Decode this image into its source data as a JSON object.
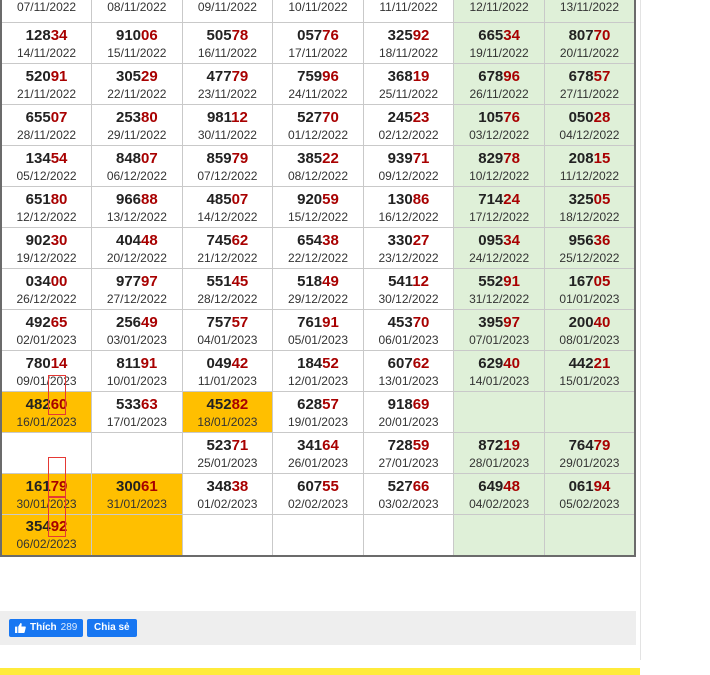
{
  "rows": [
    [
      {
        "num": "",
        "hl": "",
        "date": "07/11/2022",
        "bg": "white"
      },
      {
        "num": "",
        "hl": "",
        "date": "08/11/2022",
        "bg": "white"
      },
      {
        "num": "",
        "hl": "",
        "date": "09/11/2022",
        "bg": "white"
      },
      {
        "num": "",
        "hl": "",
        "date": "10/11/2022",
        "bg": "white"
      },
      {
        "num": "",
        "hl": "",
        "date": "11/11/2022",
        "bg": "white"
      },
      {
        "num": "",
        "hl": "",
        "date": "12/11/2022",
        "bg": "green"
      },
      {
        "num": "",
        "hl": "",
        "date": "13/11/2022",
        "bg": "green"
      }
    ],
    [
      {
        "num": "128",
        "hl": "34",
        "date": "14/11/2022",
        "bg": "white"
      },
      {
        "num": "910",
        "hl": "06",
        "date": "15/11/2022",
        "bg": "white"
      },
      {
        "num": "505",
        "hl": "78",
        "date": "16/11/2022",
        "bg": "white"
      },
      {
        "num": "057",
        "hl": "76",
        "date": "17/11/2022",
        "bg": "white"
      },
      {
        "num": "325",
        "hl": "92",
        "date": "18/11/2022",
        "bg": "white"
      },
      {
        "num": "665",
        "hl": "34",
        "date": "19/11/2022",
        "bg": "green"
      },
      {
        "num": "807",
        "hl": "70",
        "date": "20/11/2022",
        "bg": "green"
      }
    ],
    [
      {
        "num": "520",
        "hl": "91",
        "date": "21/11/2022",
        "bg": "white"
      },
      {
        "num": "305",
        "hl": "29",
        "date": "22/11/2022",
        "bg": "white"
      },
      {
        "num": "477",
        "hl": "79",
        "date": "23/11/2022",
        "bg": "white"
      },
      {
        "num": "759",
        "hl": "96",
        "date": "24/11/2022",
        "bg": "white"
      },
      {
        "num": "368",
        "hl": "19",
        "date": "25/11/2022",
        "bg": "white"
      },
      {
        "num": "678",
        "hl": "96",
        "date": "26/11/2022",
        "bg": "green"
      },
      {
        "num": "678",
        "hl": "57",
        "date": "27/11/2022",
        "bg": "green"
      }
    ],
    [
      {
        "num": "655",
        "hl": "07",
        "date": "28/11/2022",
        "bg": "white"
      },
      {
        "num": "253",
        "hl": "80",
        "date": "29/11/2022",
        "bg": "white"
      },
      {
        "num": "981",
        "hl": "12",
        "date": "30/11/2022",
        "bg": "white"
      },
      {
        "num": "527",
        "hl": "70",
        "date": "01/12/2022",
        "bg": "white"
      },
      {
        "num": "245",
        "hl": "23",
        "date": "02/12/2022",
        "bg": "white"
      },
      {
        "num": "105",
        "hl": "76",
        "date": "03/12/2022",
        "bg": "green"
      },
      {
        "num": "050",
        "hl": "28",
        "date": "04/12/2022",
        "bg": "green"
      }
    ],
    [
      {
        "num": "134",
        "hl": "54",
        "date": "05/12/2022",
        "bg": "white"
      },
      {
        "num": "848",
        "hl": "07",
        "date": "06/12/2022",
        "bg": "white"
      },
      {
        "num": "859",
        "hl": "79",
        "date": "07/12/2022",
        "bg": "white"
      },
      {
        "num": "385",
        "hl": "22",
        "date": "08/12/2022",
        "bg": "white"
      },
      {
        "num": "939",
        "hl": "71",
        "date": "09/12/2022",
        "bg": "white"
      },
      {
        "num": "829",
        "hl": "78",
        "date": "10/12/2022",
        "bg": "green"
      },
      {
        "num": "208",
        "hl": "15",
        "date": "11/12/2022",
        "bg": "green"
      }
    ],
    [
      {
        "num": "651",
        "hl": "80",
        "date": "12/12/2022",
        "bg": "white"
      },
      {
        "num": "966",
        "hl": "88",
        "date": "13/12/2022",
        "bg": "white"
      },
      {
        "num": "485",
        "hl": "07",
        "date": "14/12/2022",
        "bg": "white"
      },
      {
        "num": "920",
        "hl": "59",
        "date": "15/12/2022",
        "bg": "white"
      },
      {
        "num": "130",
        "hl": "86",
        "date": "16/12/2022",
        "bg": "white"
      },
      {
        "num": "714",
        "hl": "24",
        "date": "17/12/2022",
        "bg": "green"
      },
      {
        "num": "325",
        "hl": "05",
        "date": "18/12/2022",
        "bg": "green"
      }
    ],
    [
      {
        "num": "902",
        "hl": "30",
        "date": "19/12/2022",
        "bg": "white"
      },
      {
        "num": "404",
        "hl": "48",
        "date": "20/12/2022",
        "bg": "white"
      },
      {
        "num": "745",
        "hl": "62",
        "date": "21/12/2022",
        "bg": "white"
      },
      {
        "num": "654",
        "hl": "38",
        "date": "22/12/2022",
        "bg": "white"
      },
      {
        "num": "330",
        "hl": "27",
        "date": "23/12/2022",
        "bg": "white"
      },
      {
        "num": "095",
        "hl": "34",
        "date": "24/12/2022",
        "bg": "green"
      },
      {
        "num": "956",
        "hl": "36",
        "date": "25/12/2022",
        "bg": "green"
      }
    ],
    [
      {
        "num": "034",
        "hl": "00",
        "date": "26/12/2022",
        "bg": "white"
      },
      {
        "num": "977",
        "hl": "97",
        "date": "27/12/2022",
        "bg": "white"
      },
      {
        "num": "551",
        "hl": "45",
        "date": "28/12/2022",
        "bg": "white"
      },
      {
        "num": "518",
        "hl": "49",
        "date": "29/12/2022",
        "bg": "white"
      },
      {
        "num": "541",
        "hl": "12",
        "date": "30/12/2022",
        "bg": "white"
      },
      {
        "num": "552",
        "hl": "91",
        "date": "31/12/2022",
        "bg": "green"
      },
      {
        "num": "167",
        "hl": "05",
        "date": "01/01/2023",
        "bg": "green"
      }
    ],
    [
      {
        "num": "492",
        "hl": "65",
        "date": "02/01/2023",
        "bg": "white"
      },
      {
        "num": "256",
        "hl": "49",
        "date": "03/01/2023",
        "bg": "white"
      },
      {
        "num": "757",
        "hl": "57",
        "date": "04/01/2023",
        "bg": "white"
      },
      {
        "num": "761",
        "hl": "91",
        "date": "05/01/2023",
        "bg": "white"
      },
      {
        "num": "453",
        "hl": "70",
        "date": "06/01/2023",
        "bg": "white"
      },
      {
        "num": "395",
        "hl": "97",
        "date": "07/01/2023",
        "bg": "green"
      },
      {
        "num": "200",
        "hl": "40",
        "date": "08/01/2023",
        "bg": "green"
      }
    ],
    [
      {
        "num": "780",
        "hl": "14",
        "date": "09/01/2023",
        "bg": "white"
      },
      {
        "num": "811",
        "hl": "91",
        "date": "10/01/2023",
        "bg": "white"
      },
      {
        "num": "049",
        "hl": "42",
        "date": "11/01/2023",
        "bg": "white"
      },
      {
        "num": "184",
        "hl": "52",
        "date": "12/01/2023",
        "bg": "white"
      },
      {
        "num": "607",
        "hl": "62",
        "date": "13/01/2023",
        "bg": "white"
      },
      {
        "num": "629",
        "hl": "40",
        "date": "14/01/2023",
        "bg": "green"
      },
      {
        "num": "442",
        "hl": "21",
        "date": "15/01/2023",
        "bg": "green"
      }
    ],
    [
      {
        "num": "482",
        "hl": "60",
        "date": "16/01/2023",
        "bg": "yellow",
        "boxed": true
      },
      {
        "num": "533",
        "hl": "63",
        "date": "17/01/2023",
        "bg": "white"
      },
      {
        "num": "452",
        "hl": "82",
        "date": "18/01/2023",
        "bg": "yellow"
      },
      {
        "num": "628",
        "hl": "57",
        "date": "19/01/2023",
        "bg": "white"
      },
      {
        "num": "918",
        "hl": "69",
        "date": "20/01/2023",
        "bg": "white"
      },
      {
        "num": "",
        "hl": "",
        "date": "",
        "bg": "green"
      },
      {
        "num": "",
        "hl": "",
        "date": "",
        "bg": "green"
      }
    ],
    [
      {
        "num": "",
        "hl": "",
        "date": "",
        "bg": "white"
      },
      {
        "num": "",
        "hl": "",
        "date": "",
        "bg": "white"
      },
      {
        "num": "523",
        "hl": "71",
        "date": "25/01/2023",
        "bg": "white"
      },
      {
        "num": "341",
        "hl": "64",
        "date": "26/01/2023",
        "bg": "white"
      },
      {
        "num": "728",
        "hl": "59",
        "date": "27/01/2023",
        "bg": "white"
      },
      {
        "num": "872",
        "hl": "19",
        "date": "28/01/2023",
        "bg": "green"
      },
      {
        "num": "764",
        "hl": "79",
        "date": "29/01/2023",
        "bg": "green"
      }
    ],
    [
      {
        "num": "161",
        "hl": "79",
        "date": "30/01/2023",
        "bg": "yellow",
        "boxed": true
      },
      {
        "num": "300",
        "hl": "61",
        "date": "31/01/2023",
        "bg": "yellow"
      },
      {
        "num": "348",
        "hl": "38",
        "date": "01/02/2023",
        "bg": "white"
      },
      {
        "num": "607",
        "hl": "55",
        "date": "02/02/2023",
        "bg": "white"
      },
      {
        "num": "527",
        "hl": "66",
        "date": "03/02/2023",
        "bg": "white"
      },
      {
        "num": "649",
        "hl": "48",
        "date": "04/02/2023",
        "bg": "green"
      },
      {
        "num": "061",
        "hl": "94",
        "date": "05/02/2023",
        "bg": "green"
      }
    ],
    [
      {
        "num": "354",
        "hl": "92",
        "date": "06/02/2023",
        "bg": "yellow",
        "boxed": true
      },
      {
        "num": "",
        "hl": "",
        "date": "",
        "bg": "yellow"
      },
      {
        "num": "",
        "hl": "",
        "date": "",
        "bg": "white"
      },
      {
        "num": "",
        "hl": "",
        "date": "",
        "bg": "white"
      },
      {
        "num": "",
        "hl": "",
        "date": "",
        "bg": "white"
      },
      {
        "num": "",
        "hl": "",
        "date": "",
        "bg": "green"
      },
      {
        "num": "",
        "hl": "",
        "date": "",
        "bg": "green"
      }
    ]
  ],
  "facebook": {
    "like_label": "Thích",
    "like_count": "289",
    "share_label": "Chia sẻ"
  },
  "colors": {
    "accent_red": "#a80000",
    "highlight_yellow": "#ffbf00",
    "weekend_green": "#dff0d8",
    "facebook_blue": "#1877f2"
  }
}
